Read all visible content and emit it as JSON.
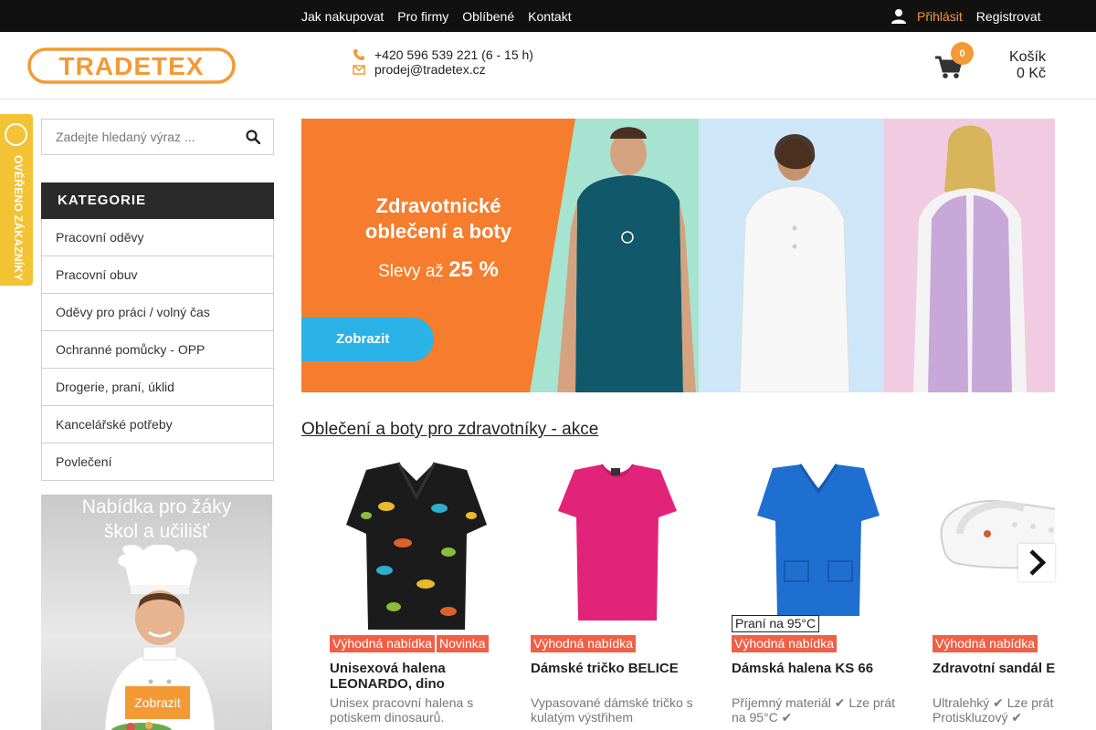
{
  "topnav": {
    "items": [
      "Jak nakupovat",
      "Pro firmy",
      "Oblíbené",
      "Kontakt"
    ],
    "login": "Přihlásit",
    "register": "Registrovat"
  },
  "header": {
    "logo_text": "TRADETEX",
    "phone": "+420 596 539 221 (6 - 15 h)",
    "email": "prodej@tradetex.cz",
    "cart_count": "0",
    "cart_label": "Košík",
    "cart_total": "0 Kč"
  },
  "stamp": {
    "text": "OVĚŘENO ZÁKAZNÍKY"
  },
  "search": {
    "placeholder": "Zadejte hledaný výraz ..."
  },
  "categories": {
    "title": "KATEGORIE",
    "items": [
      "Pracovní oděvy",
      "Pracovní obuv",
      "Oděvy pro práci / volný čas",
      "Ochranné pomůcky - OPP",
      "Drogerie, praní, úklid",
      "Kancelářské potřeby",
      "Povlečení"
    ]
  },
  "promo": {
    "title_line1": "Nabídka pro žáky",
    "title_line2": "škol a učilišť",
    "button": "Zobrazit"
  },
  "hero": {
    "line1": "Zdravotnické",
    "line2": "oblečení a boty",
    "line3_prefix": "Slevy až",
    "line3_value": "25 %",
    "button": "Zobrazit"
  },
  "section": {
    "title": "Oblečení a boty pro zdravotníky - akce"
  },
  "products": [
    {
      "tags": [
        "Výhodná nabídka",
        "Novinka"
      ],
      "name": "Unisexová halena LEONARDO, dino",
      "desc": "Unisex pracovní halena s potiskem dinosaurů."
    },
    {
      "tags": [
        "Výhodná nabídka"
      ],
      "name": "Dámské tričko BELICE",
      "desc": "Vypasované dámské tričko s kulatým výstřihem"
    },
    {
      "tags": [
        "Výhodná nabídka"
      ],
      "wash_tag": "Praní na 95°C",
      "name": "Dámská halena KS 66",
      "desc": "Příjemný materiál ✔ Lze prát na 95°C ✔"
    },
    {
      "tags": [
        "Výhodná nabídka"
      ],
      "name": "Zdravotní sandál E",
      "desc": "Ultralehký ✔ Lze prát Protiskluzový ✔"
    }
  ],
  "colors": {
    "accent": "#f39a35",
    "tag": "#f06046",
    "dark": "#111111",
    "hero_orange": "#f57d2d",
    "hero_button": "#2bb2e6"
  }
}
